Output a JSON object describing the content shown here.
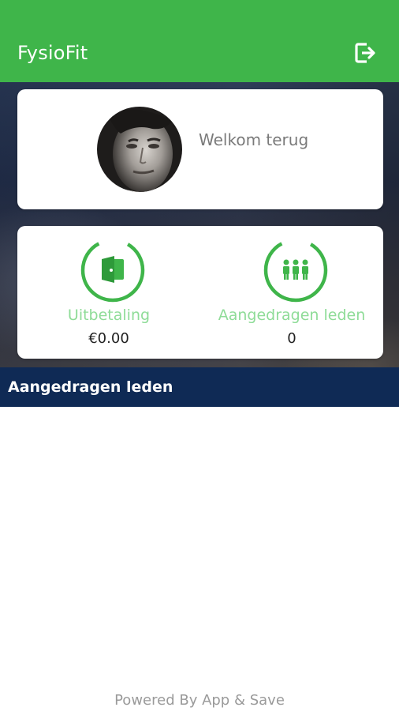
{
  "appbar": {
    "title": "FysioFit",
    "logout_icon": "logout-icon",
    "background_color": "#3fb54a"
  },
  "welcome": {
    "text": "Welkom terug",
    "avatar_icon": "user-avatar"
  },
  "stats": [
    {
      "label": "Uitbetaling",
      "value": "€0.00",
      "icon": "wallet-icon"
    },
    {
      "label": "Aangedragen leden",
      "value": "0",
      "icon": "people-icon"
    }
  ],
  "section": {
    "title": "Aangedragen leden",
    "background_color": "#0f2a55"
  },
  "footer": {
    "text": "Powered By App & Save"
  },
  "accent_color": "#3fb54a"
}
